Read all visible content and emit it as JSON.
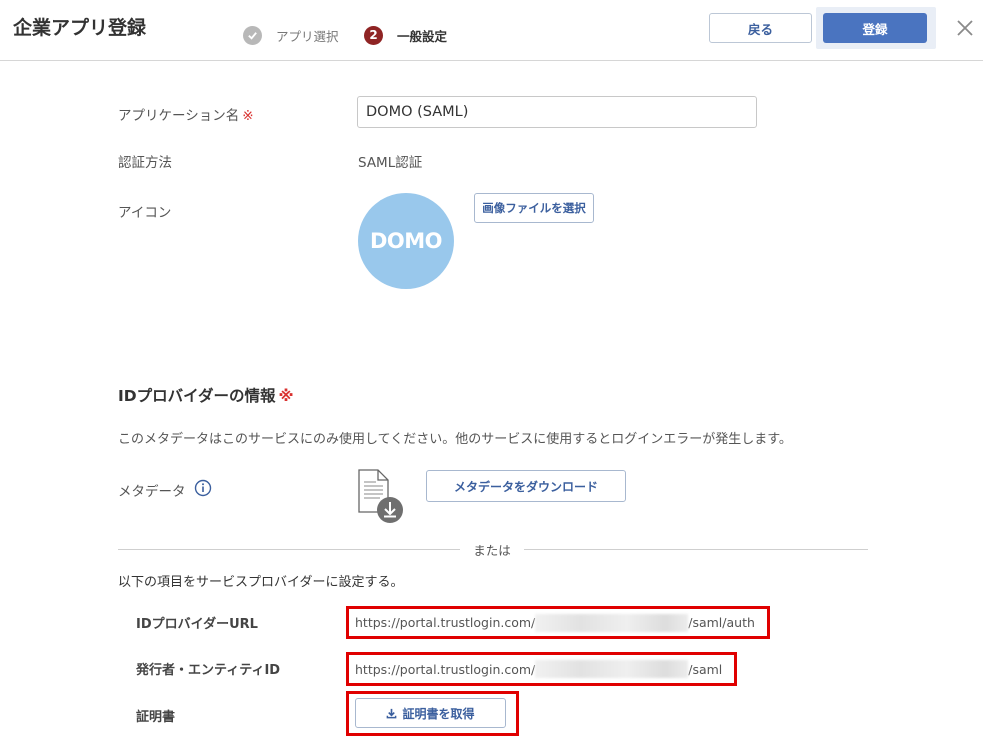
{
  "header": {
    "title": "企業アプリ登録",
    "steps": [
      {
        "label": "アプリ選択",
        "status": "done"
      },
      {
        "number": "2",
        "label": "一般設定",
        "status": "current"
      }
    ],
    "back_label": "戻る",
    "register_label": "登録"
  },
  "form": {
    "app_name_label": "アプリケーション名",
    "required_mark": "※",
    "app_name_value": "DOMO (SAML)",
    "auth_method_label": "認証方法",
    "auth_method_value": "SAML認証",
    "icon_label": "アイコン",
    "icon_logo_text": "DOMO",
    "select_image_label": "画像ファイルを選択"
  },
  "idp": {
    "section_title": "IDプロバイダーの情報",
    "required_mark": "※",
    "description": "このメタデータはこのサービスにのみ使用してください。他のサービスに使用するとログインエラーが発生します。",
    "metadata_label": "メタデータ",
    "download_label": "メタデータをダウンロード",
    "or_text": "または",
    "sub_description": "以下の項目をサービスプロバイダーに設定する。",
    "idp_url_label": "IDプロバイダーURL",
    "idp_url_prefix": "https://portal.trustlogin.com/",
    "idp_url_suffix": "/saml/auth",
    "issuer_label": "発行者・エンティティID",
    "issuer_prefix": "https://portal.trustlogin.com/",
    "issuer_suffix": "/saml",
    "cert_label": "証明書",
    "cert_button_label": "証明書を取得"
  },
  "colors": {
    "primary": "#4a74c0",
    "accent_text": "#3b5f9e",
    "required": "#d9312f",
    "step_current": "#8f2424",
    "highlight_border": "#e00000",
    "domo_logo_bg": "#99c8ec"
  }
}
